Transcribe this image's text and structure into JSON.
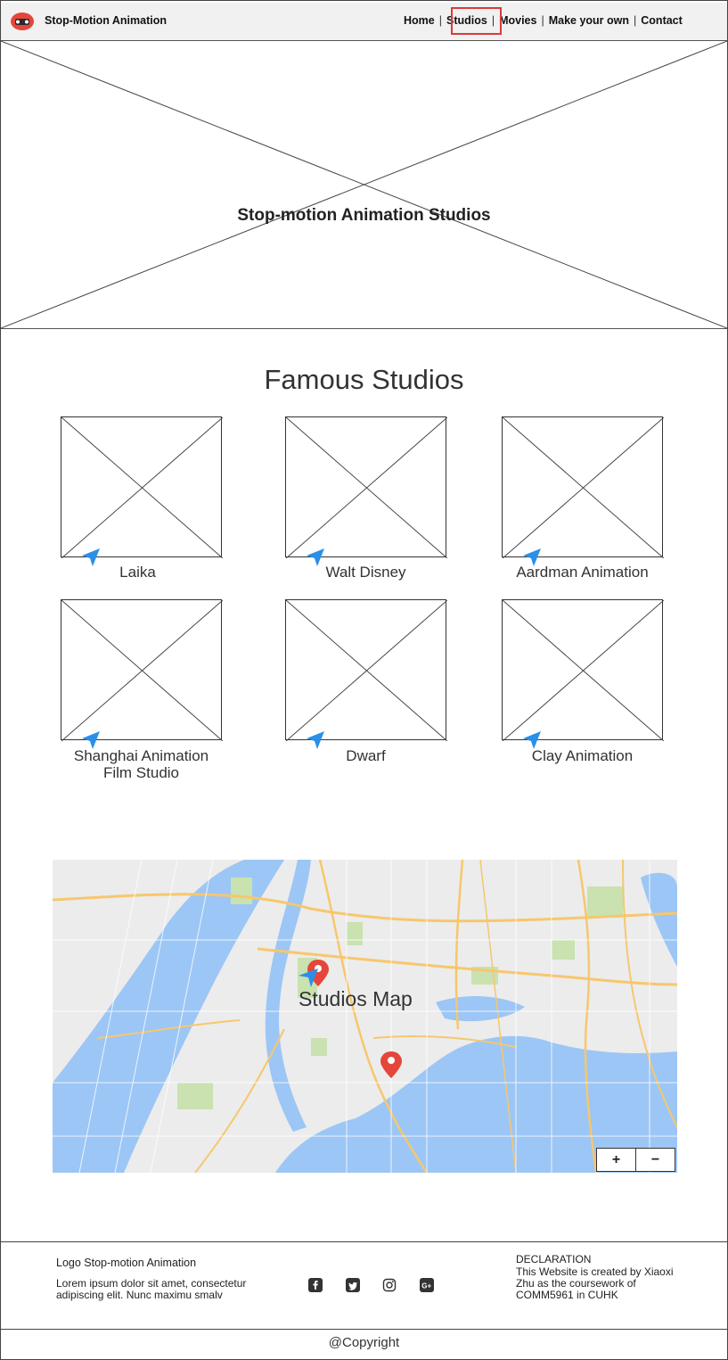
{
  "header": {
    "site_title": "Stop-Motion Animation",
    "nav": [
      "Home",
      "Studios",
      "Movies",
      "Make your own",
      "Contact"
    ],
    "active_nav": "Studios"
  },
  "hero": {
    "title": "Stop-motion Animation Studios"
  },
  "studios": {
    "title": "Famous Studios",
    "items": [
      {
        "name": "Laika"
      },
      {
        "name": "Walt Disney"
      },
      {
        "name": "Aardman Animation"
      },
      {
        "name": "Shanghai Animation Film Studio"
      },
      {
        "name": "Dwarf"
      },
      {
        "name": "Clay Animation"
      }
    ]
  },
  "map": {
    "title": "Studios Map",
    "zoom_in": "+",
    "zoom_out": "−"
  },
  "footer": {
    "logo_text": "Logo Stop-motion Animation",
    "lorem": "Lorem ipsum dolor sit amet, consectetur adipiscing elit. Nunc maximu smalv",
    "declaration_title": "DECLARATION",
    "declaration_text": "This Website is created by Xiaoxi Zhu as the coursework of COMM5961 in CUHK",
    "social_icons": [
      "facebook-icon",
      "twitter-icon",
      "instagram-icon",
      "google-plus-icon"
    ]
  },
  "copyright": "@Copyright",
  "colors": {
    "accent_red": "#d93a3a",
    "pin_red": "#e5453a",
    "arrow_blue": "#2a8fe8",
    "water": "#9cc6f5",
    "park": "#c9e2b0",
    "road": "#f6c76d"
  }
}
